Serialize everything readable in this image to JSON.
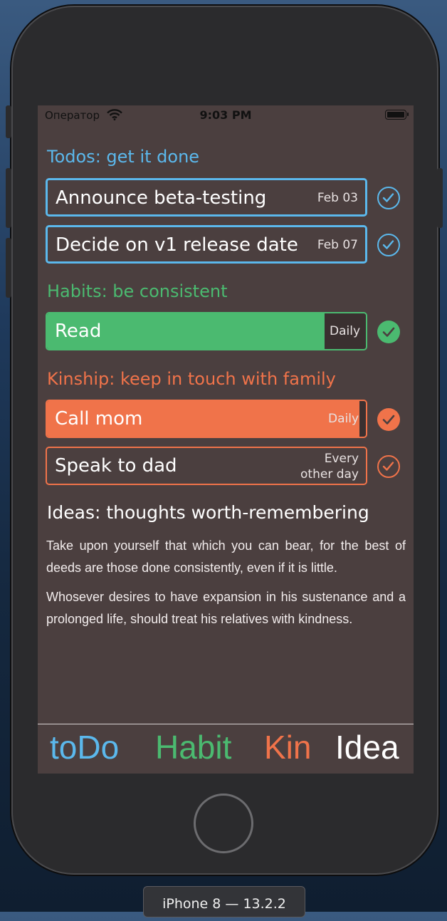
{
  "status_bar": {
    "carrier": "Оператор",
    "time": "9:03 PM"
  },
  "colors": {
    "todo": "#5bb8ec",
    "habit": "#4bba70",
    "kin": "#f0734a",
    "idea": "#ffffff",
    "screen_bg": "#4b3f3f"
  },
  "todos": {
    "title": "Todos: get it done",
    "items": [
      {
        "label": "Announce beta-testing",
        "date": "Feb 03"
      },
      {
        "label": "Decide on v1 release date",
        "date": "Feb 07"
      }
    ]
  },
  "habits": {
    "title": "Habits: be consistent",
    "items": [
      {
        "label": "Read",
        "frequency": "Daily",
        "progress": 0.87
      }
    ]
  },
  "kinship": {
    "title": "Kinship: keep in touch with family",
    "items": [
      {
        "label": "Call mom",
        "frequency": "Daily",
        "progress": 0.98
      },
      {
        "label": "Speak to dad",
        "frequency_line1": "Every",
        "frequency_line2": "other day",
        "progress": 0
      }
    ]
  },
  "ideas": {
    "title": "Ideas: thoughts worth-remembering",
    "quotes": [
      "Take upon yourself that which you can bear, for the best of deeds are those done consistently, even if it is little.",
      "Whosever desires to have expansion in his sustenance and a prolonged life, should treat his relatives with kindness."
    ]
  },
  "tabs": [
    "toDo",
    "Habit",
    "Kin",
    "Idea"
  ],
  "device_label": "iPhone 8 — 13.2.2"
}
